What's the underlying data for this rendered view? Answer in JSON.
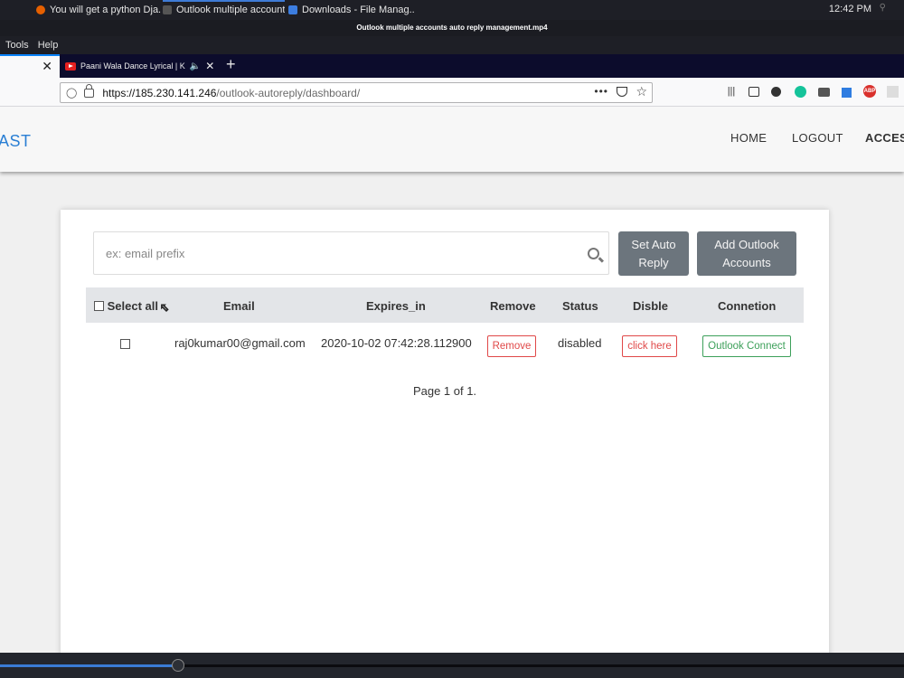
{
  "taskbar": {
    "tasks": [
      {
        "label": "You will get a python Dja..."
      },
      {
        "label": "Outlook multiple account..."
      },
      {
        "label": "Downloads - File Manag..."
      }
    ],
    "clock": "12:42 PM"
  },
  "video": {
    "title": "Outlook multiple accounts auto reply management.mp4",
    "progress": 0.197
  },
  "menubar": {
    "items": [
      "Tools",
      "Help"
    ]
  },
  "browser": {
    "tabs": [
      {
        "label": ""
      },
      {
        "label": "Paani Wala Dance Lyrical | K"
      }
    ],
    "url_host": "https://185.230.141.246",
    "url_path": "/outlook-autoreply/dashboard/",
    "toolbar_icons": [
      "library-icon",
      "sidebar-icon",
      "account-icon",
      "grammarly-icon",
      "extension-icon",
      "translate-icon",
      "adblock-icon",
      "extension-2-icon"
    ]
  },
  "site": {
    "brand": "AST",
    "nav": {
      "home": "HOME",
      "logout": "LOGOUT",
      "access": "ACCESS"
    }
  },
  "dashboard": {
    "search_placeholder": "ex: email prefix",
    "set_auto_reply": "Set Auto Reply",
    "add_outlook_accounts": "Add Outlook Accounts",
    "columns": {
      "select_all": "Select all",
      "email": "Email",
      "expires_in": "Expires_in",
      "remove": "Remove",
      "status": "Status",
      "disable": "Disble",
      "connection": "Connetion"
    },
    "rows": [
      {
        "email": "raj0kumar00@gmail.com",
        "expires_in": "2020-10-02 07:42:28.112900",
        "remove_label": "Remove",
        "status": "disabled",
        "disable_label": "click here",
        "connect_label": "Outlook Connect"
      }
    ],
    "pagination": "Page 1 of 1."
  },
  "colors": {
    "brand": "#2a7fd4",
    "button_grey": "#6c757d",
    "danger": "#e04848",
    "success": "#3da05a",
    "tab_accent": "#0a84ff"
  }
}
